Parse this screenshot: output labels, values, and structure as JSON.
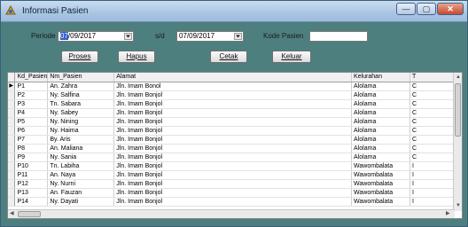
{
  "window": {
    "title": "Informasi Pasien",
    "controls": [
      "—",
      "▢",
      "✕"
    ]
  },
  "filter": {
    "periode_label": "Periode",
    "date_from_day": "07",
    "date_from_rest": "/09/2017",
    "sd_label": "s/d",
    "date_to": "07/09/2017",
    "kode_label": "Kode Pasien",
    "kode_value": ""
  },
  "buttons": {
    "proses": "Proses",
    "hapus": "Hapus",
    "cetak": "Cetak",
    "keluar": "Keluar"
  },
  "table": {
    "columns": [
      "Kd_Pasien",
      "Nm_Pasien",
      "Alamat",
      "Kelurahan",
      "T"
    ],
    "current_row_marker": "▶",
    "rows": [
      [
        "P1",
        "An. Zahra",
        "Jln. Imam Bonol",
        "Alolama",
        "C"
      ],
      [
        "P2",
        "Ny. Salfina",
        "Jln. Imam Bonjol",
        "Alolama",
        "C"
      ],
      [
        "P3",
        "Tn. Sabara",
        "Jln. Imam Bonjol",
        "Alolama",
        "C"
      ],
      [
        "P4",
        "Ny. Sabey",
        "Jln. Imam Bonjol",
        "Alolama",
        "C"
      ],
      [
        "P5",
        "Ny. Nining",
        "Jln. Imam Bonjol",
        "Alolama",
        "C"
      ],
      [
        "P6",
        "Ny. Haima",
        "Jln. Imam Bonjol",
        "Alolama",
        "C"
      ],
      [
        "P7",
        "By. Aris",
        "Jln. Imam Bonjol",
        "Alolama",
        "C"
      ],
      [
        "P8",
        "An. Maliana",
        "Jln. Imam Bonjol",
        "Alolama",
        "C"
      ],
      [
        "P9",
        "Ny. Sania",
        "Jln. Imam Bonjol",
        "Alolama",
        "C"
      ],
      [
        "P10",
        "Tn. Labiha",
        "Jln. Imam Bonjol",
        "Wawombalata",
        "I"
      ],
      [
        "P11",
        "An. Naya",
        "Jln. Imam Bonjol",
        "Wawombalata",
        "I"
      ],
      [
        "P12",
        "Ny. Nurni",
        "Jln. Imam Bonjol",
        "Wawombalata",
        "I"
      ],
      [
        "P13",
        "An. Fauzan",
        "Jln. Imam Bonjol",
        "Wawombalata",
        "I"
      ],
      [
        "P14",
        "Ny. Dayati",
        "Jln. Imam Bonjol",
        "Wawombalata",
        "I"
      ]
    ]
  }
}
